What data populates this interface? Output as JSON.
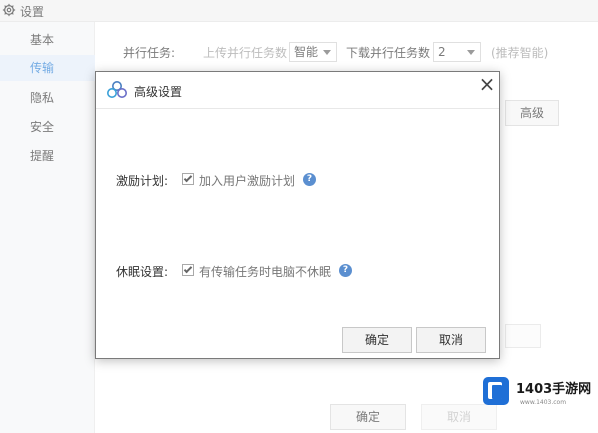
{
  "window": {
    "title": "设置",
    "icon": "gear-icon"
  },
  "sidebar": {
    "items": [
      {
        "label": "基本"
      },
      {
        "label": "传输"
      },
      {
        "label": "隐私"
      },
      {
        "label": "安全"
      },
      {
        "label": "提醒"
      }
    ],
    "active_index": 1
  },
  "background": {
    "parallel_label": "并行任务:",
    "upload_label": "上传并行任务数",
    "upload_value": "智能",
    "download_label": "下载并行任务数",
    "download_value": "2",
    "hint": "(推荐智能)",
    "right_button": "高级",
    "ok_label": "确定",
    "cancel_label": "取消"
  },
  "modal": {
    "title": "高级设置",
    "close_icon": "close-icon",
    "options": [
      {
        "label": "激励计划:",
        "text": "加入用户激励计划",
        "checked": true
      },
      {
        "label": "休眠设置:",
        "text": "有传输任务时电脑不休眠",
        "checked": true
      }
    ],
    "ok_label": "确定",
    "cancel_label": "取消"
  },
  "watermark": {
    "name": "1403手游网",
    "url": "www.1403.com"
  }
}
